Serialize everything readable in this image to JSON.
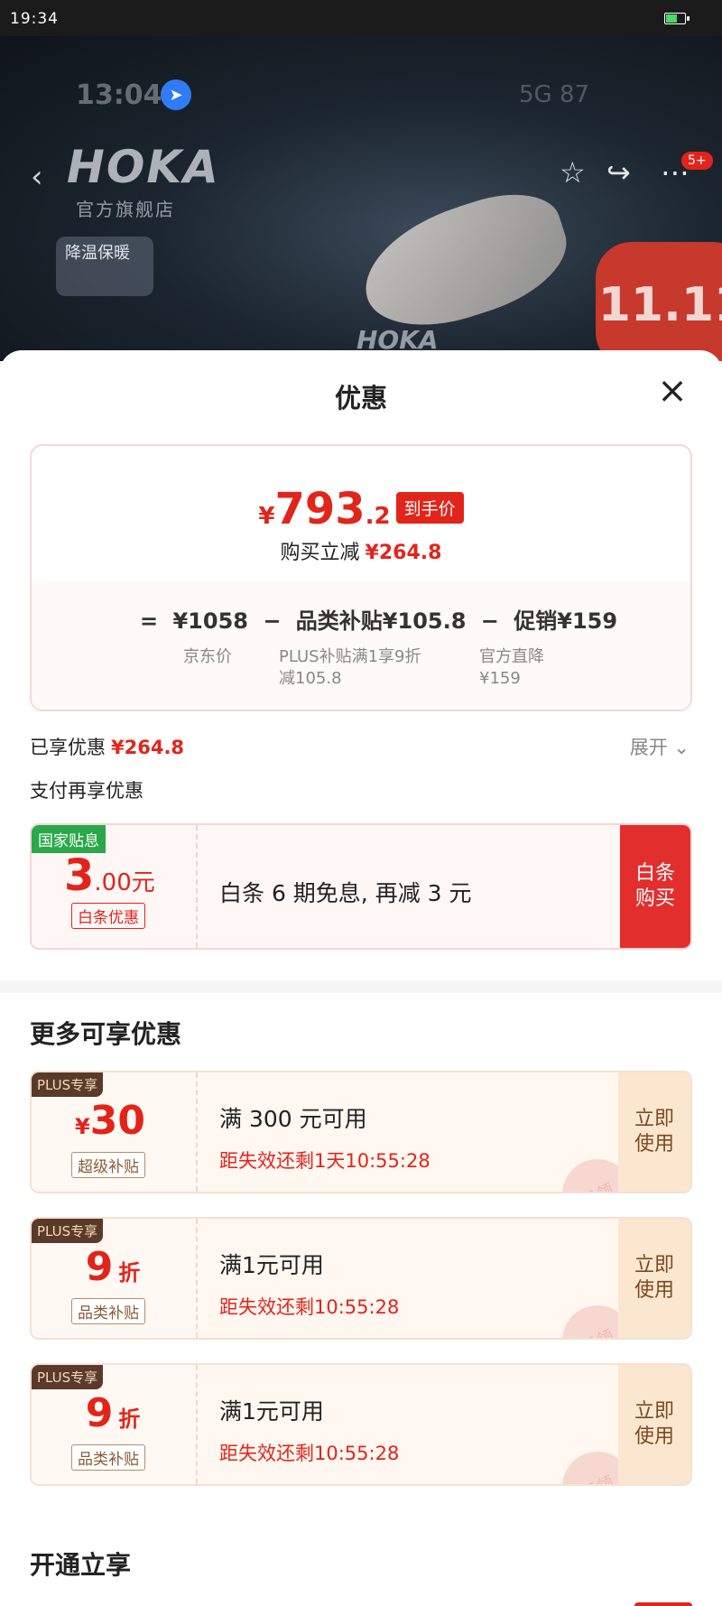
{
  "status_bar": {
    "time": "19:34"
  },
  "background_ui": {
    "time": "13:04",
    "network": "5G 87",
    "brand": "HOKA",
    "brand_subtitle": "官方旗舰店",
    "promo_tag": "降温保暖",
    "badge": "5+",
    "event_badge": "11.11",
    "brand_watermark": "HOKA",
    "icons": [
      "back-icon",
      "star-icon",
      "share-icon",
      "more-icon",
      "location-icon"
    ]
  },
  "sheet": {
    "title": "优惠",
    "final_price": {
      "currency": "¥",
      "integer": "793",
      "decimal": ".2",
      "tag": "到手价"
    },
    "reduction": {
      "label": "购买立减",
      "amount": "¥264.8"
    },
    "formula": {
      "eq": "=",
      "base_price": "¥1058",
      "minus1": "−",
      "subsidy": "品类补贴¥105.8",
      "minus2": "−",
      "promo": "促销¥159"
    },
    "notes": {
      "base_label": "京东价",
      "subsidy_line1": "PLUS补贴满1享9折",
      "subsidy_line2": "减105.8",
      "promo_line1": "官方直降",
      "promo_line2": "¥159"
    },
    "enjoyed": {
      "label": "已享优惠",
      "amount": "¥264.8",
      "expand_label": "展开"
    },
    "pay_title": "支付再享优惠",
    "pay_coupon": {
      "badge": "国家贴息",
      "amount_big": "3",
      "amount_small": ".00元",
      "type_tag": "白条优惠",
      "description": "白条 6 期免息, 再减 3 元",
      "action": "白条购买"
    },
    "more_title": "更多可享优惠",
    "plus_coupons": [
      {
        "tag": "PLUS专享",
        "prefix": "¥",
        "value": "30",
        "unit": "",
        "type": "超级补贴",
        "condition": "满 300 元可用",
        "countdown": "距失效还剩1天10:55:28",
        "stamp": "已领",
        "action": "立即使用"
      },
      {
        "tag": "PLUS专享",
        "prefix": "",
        "value": "9",
        "unit": "折",
        "type": "品类补贴",
        "condition": "满1元可用",
        "countdown": "距失效还剩10:55:28",
        "stamp": "已领",
        "action": "立即使用"
      },
      {
        "tag": "PLUS专享",
        "prefix": "",
        "value": "9",
        "unit": "折",
        "type": "品类补贴",
        "condition": "满1元可用",
        "countdown": "距失效还剩10:55:28",
        "stamp": "已领",
        "action": "立即使用"
      }
    ],
    "open_title": "开通立享"
  },
  "colors": {
    "accent_red": "#e1251b",
    "national_green": "#2aa84a",
    "plus_brown": "#5b3a2a"
  }
}
